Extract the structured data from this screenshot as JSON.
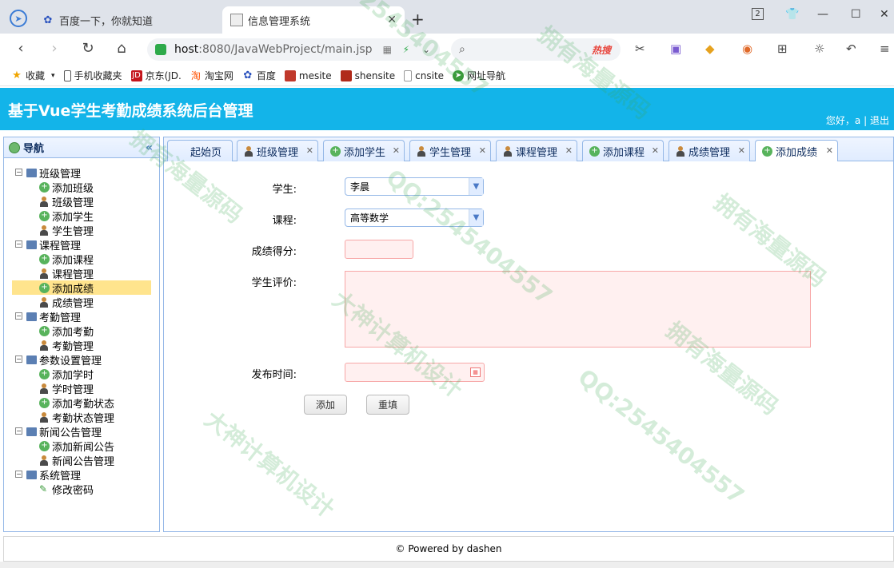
{
  "browser": {
    "tabs": [
      {
        "title": "百度一下，你就知道",
        "active": false
      },
      {
        "title": "信息管理系统",
        "active": true
      }
    ],
    "window_badge": "2",
    "address": {
      "host": "host",
      "path": ":8080/JavaWebProject/main.jsp"
    },
    "search": {
      "hot_label": "热搜"
    },
    "bookmarks": [
      "收藏",
      "手机收藏夹",
      "京东(JD.",
      "淘宝网",
      "百度",
      "mesite",
      "shensite",
      "cnsite",
      "网址导航"
    ]
  },
  "app": {
    "title": "基于Vue学生考勤成绩系统后台管理",
    "greeting": "您好，a",
    "separator": "|",
    "logout": "退出"
  },
  "sidebar": {
    "header": "导航",
    "groups": [
      {
        "label": "班级管理",
        "items": [
          "添加班级",
          "班级管理",
          "添加学生",
          "学生管理"
        ]
      },
      {
        "label": "课程管理",
        "items": [
          "添加课程",
          "课程管理",
          "添加成绩",
          "成绩管理"
        ]
      },
      {
        "label": "考勤管理",
        "items": [
          "添加考勤",
          "考勤管理"
        ]
      },
      {
        "label": "参数设置管理",
        "items": [
          "添加学时",
          "学时管理",
          "添加考勤状态",
          "考勤状态管理"
        ]
      },
      {
        "label": "新闻公告管理",
        "items": [
          "添加新闻公告",
          "新闻公告管理"
        ]
      },
      {
        "label": "系统管理",
        "items": [
          "修改密码"
        ]
      }
    ],
    "selected": "添加成绩"
  },
  "tabs": [
    "起始页",
    "班级管理",
    "添加学生",
    "学生管理",
    "课程管理",
    "添加课程",
    "成绩管理",
    "添加成绩"
  ],
  "form": {
    "student_label": "学生:",
    "student_value": "李晨",
    "course_label": "课程:",
    "course_value": "高等数学",
    "score_label": "成绩得分:",
    "comment_label": "学生评价:",
    "publish_label": "发布时间:",
    "add_button": "添加",
    "reset_button": "重填"
  },
  "footer": "© Powered by dashen",
  "watermark": [
    "大神计算机设计",
    "QQ:2545404557",
    "拥有海量源码"
  ]
}
